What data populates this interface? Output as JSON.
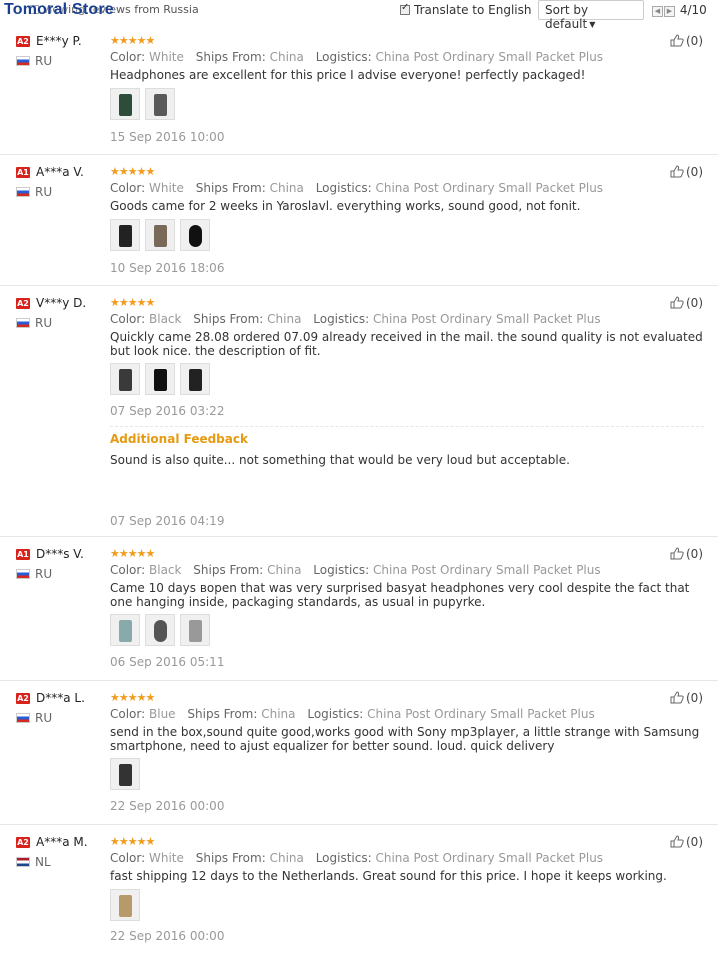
{
  "toolbar": {
    "store_name": "Tomoral Store",
    "viewing_label": "Viewing reviews from Russia",
    "translate_label": "Translate to English",
    "sort_label": "Sort by default",
    "page_indicator": "4/10"
  },
  "labels": {
    "color": "Color:",
    "ships_from": "Ships From:",
    "logistics": "Logistics:",
    "additional_feedback": "Additional Feedback"
  },
  "reviews": [
    {
      "level": "A2",
      "name": "E***y P.",
      "country": "RU",
      "color": "White",
      "ships_from": "China",
      "logistics": "China Post Ordinary Small Packet Plus",
      "text": "Headphones are excellent for this price I advise everyone! perfectly packaged!",
      "date": "15 Sep 2016 10:00",
      "helpful": "(0)"
    },
    {
      "level": "A1",
      "name": "A***a V.",
      "country": "RU",
      "color": "White",
      "ships_from": "China",
      "logistics": "China Post Ordinary Small Packet Plus",
      "text": "Goods came for 2 weeks in Yaroslavl. everything works, sound good, not fonit.",
      "date": "10 Sep 2016 18:06",
      "helpful": "(0)"
    },
    {
      "level": "A2",
      "name": "V***y D.",
      "country": "RU",
      "color": "Black",
      "ships_from": "China",
      "logistics": "China Post Ordinary Small Packet Plus",
      "text": "Quickly came 28.08 ordered 07.09 already received in the mail. the sound quality is not evaluated but look nice. the description of fit.",
      "date": "07 Sep 2016 03:22",
      "additional_text": "Sound is also quite... not something that would be very loud but acceptable.",
      "additional_date": "07 Sep 2016 04:19",
      "helpful": "(0)"
    },
    {
      "level": "A1",
      "name": "D***s V.",
      "country": "RU",
      "color": "Black",
      "ships_from": "China",
      "logistics": "China Post Ordinary Small Packet Plus",
      "text": "Came 10 days вореn that was very surprised basyat headphones very cool despite the fact that one hanging inside, packaging standards, as usual in pupyrke.",
      "date": "06 Sep 2016 05:11",
      "helpful": "(0)"
    },
    {
      "level": "A2",
      "name": "D***a L.",
      "country": "RU",
      "color": "Blue",
      "ships_from": "China",
      "logistics": "China Post Ordinary Small Packet Plus",
      "text": "send in the box,sound quite good,works good with Sony mp3player, a little strange with Samsung smartphone, need to ajust equalizer for better sound. loud. quick delivery",
      "date": "22 Sep 2016 00:00",
      "helpful": "(0)"
    },
    {
      "level": "A2",
      "name": "A***a M.",
      "country": "NL",
      "color": "White",
      "ships_from": "China",
      "logistics": "China Post Ordinary Small Packet Plus",
      "text": "fast shipping 12 days to the Netherlands. Great sound for this price. I hope it keeps working.",
      "date": "22 Sep 2016 00:00",
      "helpful": "(0)"
    }
  ],
  "stars": "★★★★★",
  "colors": {
    "level_badge": "#d8221c",
    "stars": "#f29b1d",
    "additional_feedback": "#e59a10"
  }
}
